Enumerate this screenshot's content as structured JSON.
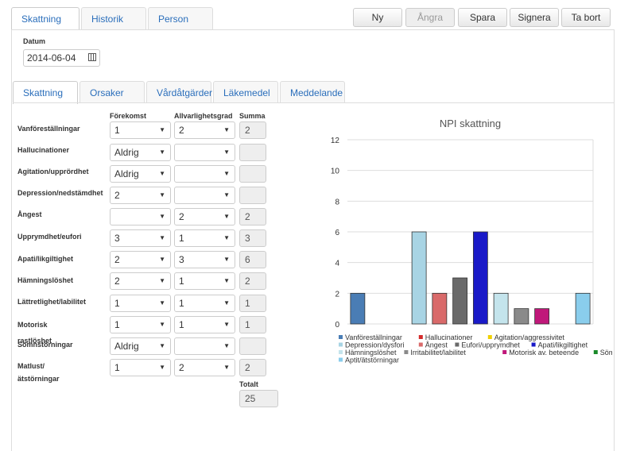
{
  "top_tabs": [
    "Skattning",
    "Historik",
    "Person"
  ],
  "toolbar": {
    "ny": "Ny",
    "angra": "Ångra",
    "spara": "Spara",
    "signera": "Signera",
    "ta_bort": "Ta bort"
  },
  "date_label": "Datum",
  "date_value": "2014-06-04",
  "sub_tabs": [
    "Skattning",
    "Orsaker",
    "Vårdåtgärder",
    "Läkemedel",
    "Meddelande"
  ],
  "columns": {
    "forekomst": "Förekomst",
    "allvarlighetsgrad": "Allvarlighetsgrad",
    "summa": "Summa"
  },
  "rows": [
    {
      "label": "Vanföreställningar",
      "forekomst": "1",
      "allvarlighet": "2",
      "summa": "2"
    },
    {
      "label": "Hallucinationer",
      "forekomst": "Aldrig",
      "allvarlighet": "",
      "summa": ""
    },
    {
      "label": "Agitation/upprördhet",
      "forekomst": "Aldrig",
      "allvarlighet": "",
      "summa": ""
    },
    {
      "label": "Depression/nedstämdhet",
      "forekomst": "2",
      "allvarlighet": "",
      "summa": ""
    },
    {
      "label": "Ångest",
      "forekomst": "",
      "allvarlighet": "2",
      "summa": "2"
    },
    {
      "label": "Upprymdhet/eufori",
      "forekomst": "3",
      "allvarlighet": "1",
      "summa": "3"
    },
    {
      "label": "Apati/likgiltighet",
      "forekomst": "2",
      "allvarlighet": "3",
      "summa": "6"
    },
    {
      "label": "Hämningslöshet",
      "forekomst": "2",
      "allvarlighet": "1",
      "summa": "2"
    },
    {
      "label": "Lättretlighet/labilitet",
      "forekomst": "1",
      "allvarlighet": "1",
      "summa": "1"
    },
    {
      "label": "Motorisk rastlöshet",
      "forekomst": "1",
      "allvarlighet": "1",
      "summa": "1"
    },
    {
      "label": "Sömnstörningar",
      "forekomst": "Aldrig",
      "allvarlighet": "",
      "summa": ""
    },
    {
      "label": "Matlust/ ätstörningar",
      "forekomst": "1",
      "allvarlighet": "2",
      "summa": "2"
    }
  ],
  "total_label": "Totalt",
  "total_value": "25",
  "chart_data": {
    "type": "bar",
    "title": "NPI skattning",
    "ylim": [
      0,
      12
    ],
    "yticks": [
      0,
      2,
      4,
      6,
      8,
      10,
      12
    ],
    "grid": true,
    "legend_position": "bottom",
    "series": [
      {
        "name": "Vanföreställningar",
        "value": 2,
        "color": "#4a7db5"
      },
      {
        "name": "Hallucinationer",
        "value": 0,
        "color": "#d42a2a"
      },
      {
        "name": "Agitation/aggressivitet",
        "value": 0,
        "color": "#f0d000"
      },
      {
        "name": "Depression/dysfori",
        "value": 6,
        "color": "#a8d4e4"
      },
      {
        "name": "Ångest",
        "value": 2,
        "color": "#d96a6a"
      },
      {
        "name": "Eufori/upprymdhet",
        "value": 3,
        "color": "#6a6a6a"
      },
      {
        "name": "Apati/likgiltighet",
        "value": 6,
        "color": "#1a1ac8"
      },
      {
        "name": "Hämningslöshet",
        "value": 2,
        "color": "#c4e4ec"
      },
      {
        "name": "Irritabilitet/labilitet",
        "value": 1,
        "color": "#8a8a8a"
      },
      {
        "name": "Motorisk av. beteende",
        "value": 1,
        "color": "#c0187a"
      },
      {
        "name": "Sömn",
        "value": 0,
        "color": "#1a8a2a"
      },
      {
        "name": "Aptit/ätstörningar",
        "value": 2,
        "color": "#8acdec"
      }
    ]
  }
}
